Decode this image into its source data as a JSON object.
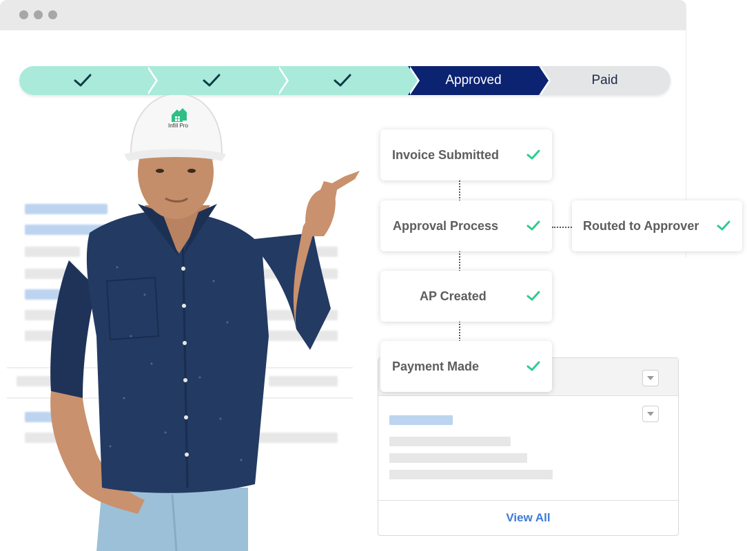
{
  "window": {
    "controls": [
      "close",
      "minimize",
      "maximize"
    ]
  },
  "stepper": {
    "steps": [
      {
        "state": "done",
        "icon": "check-icon"
      },
      {
        "state": "done",
        "icon": "check-icon"
      },
      {
        "state": "done",
        "icon": "check-icon"
      },
      {
        "state": "active",
        "label": "Approved"
      },
      {
        "state": "pending",
        "label": "Paid"
      }
    ],
    "colors": {
      "done": "#a9eadb",
      "active": "#0c2372",
      "pending": "#e4e5e6",
      "check": "#0c3b4a"
    }
  },
  "helmet_logo": {
    "text": "Infill Pro"
  },
  "flow": {
    "invoice_submitted": "Invoice Submitted",
    "approval_process": "Approval Process",
    "routed_to_approver": "Routed to Approver",
    "ap_created": "AP Created",
    "payment_made": "Payment Made",
    "check_color": "#2ecc8f"
  },
  "panel": {
    "view_all": "View All",
    "link_color": "#3d7bd6"
  }
}
